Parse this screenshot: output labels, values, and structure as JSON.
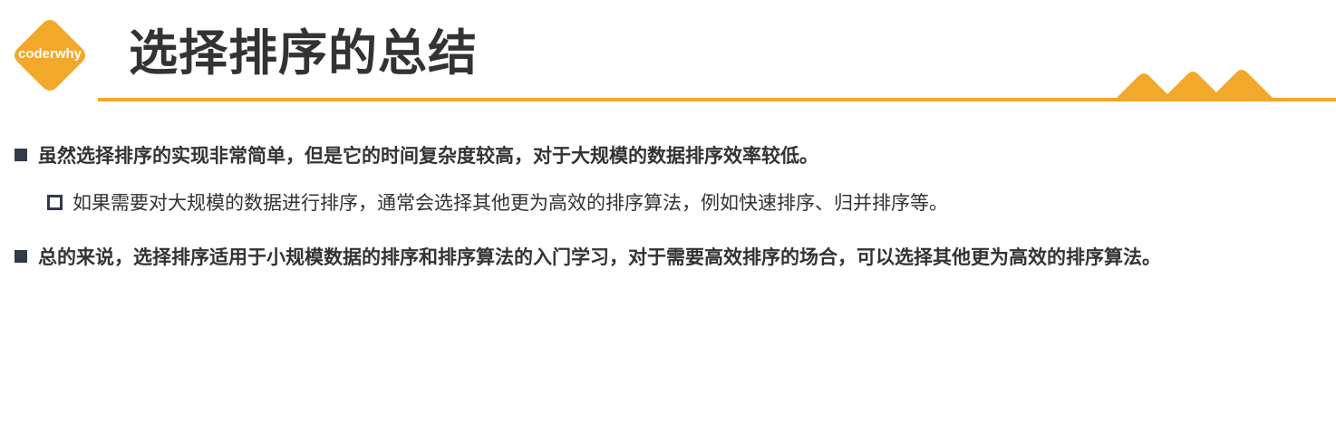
{
  "logo": {
    "text": "coderwhy"
  },
  "title": "选择排序的总结",
  "bullets": [
    {
      "level": 1,
      "text": "虽然选择排序的实现非常简单，但是它的时间复杂度较高，对于大规模的数据排序效率较低。"
    },
    {
      "level": 2,
      "text": "如果需要对大规模的数据进行排序，通常会选择其他更为高效的排序算法，例如快速排序、归并排序等。"
    },
    {
      "level": 1,
      "text": "总的来说，选择排序适用于小规模数据的排序和排序算法的入门学习，对于需要高效排序的场合，可以选择其他更为高效的排序算法。"
    }
  ],
  "colors": {
    "accent": "#F2A82A",
    "text": "#333333",
    "bullet": "#333a4a",
    "background": "#ffffff"
  }
}
